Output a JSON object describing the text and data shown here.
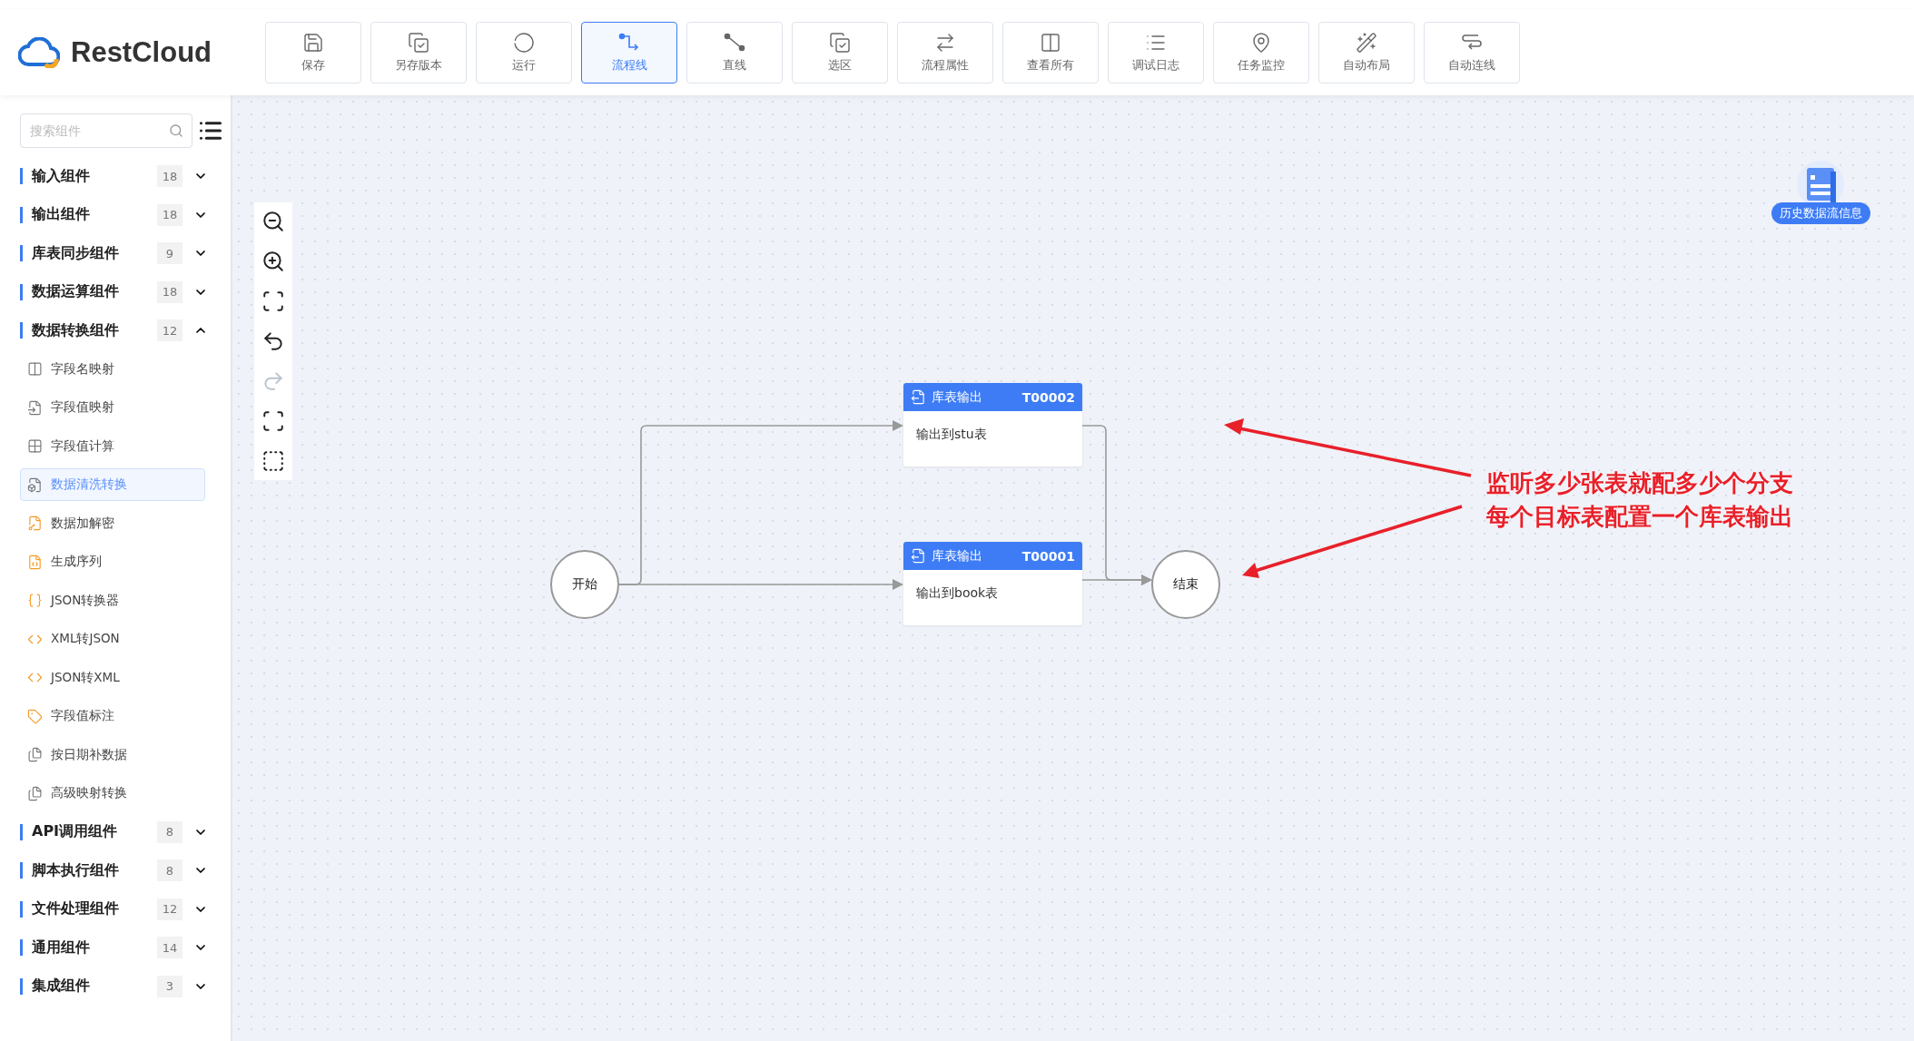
{
  "logo": {
    "text": "RestCloud"
  },
  "toolbar": [
    {
      "label": "保存",
      "selected": false
    },
    {
      "label": "另存版本",
      "selected": false
    },
    {
      "label": "运行",
      "selected": false
    },
    {
      "label": "流程线",
      "selected": true
    },
    {
      "label": "直线",
      "selected": false
    },
    {
      "label": "选区",
      "selected": false
    },
    {
      "label": "流程属性",
      "selected": false
    },
    {
      "label": "查看所有",
      "selected": false
    },
    {
      "label": "调试日志",
      "selected": false
    },
    {
      "label": "任务监控",
      "selected": false
    },
    {
      "label": "自动布局",
      "selected": false
    },
    {
      "label": "自动连线",
      "selected": false
    }
  ],
  "sidebar": {
    "search": {
      "placeholder": "搜索组件"
    },
    "groups": [
      {
        "label": "输入组件",
        "count": "18",
        "expanded": false
      },
      {
        "label": "输出组件",
        "count": "18",
        "expanded": false
      },
      {
        "label": "库表同步组件",
        "count": "9",
        "expanded": false
      },
      {
        "label": "数据运算组件",
        "count": "18",
        "expanded": false
      },
      {
        "label": "数据转换组件",
        "count": "12",
        "expanded": true,
        "children": [
          {
            "label": "字段名映射",
            "selected": false
          },
          {
            "label": "字段值映射",
            "selected": false
          },
          {
            "label": "字段值计算",
            "selected": false
          },
          {
            "label": "数据清洗转换",
            "selected": true
          },
          {
            "label": "数据加解密",
            "selected": false
          },
          {
            "label": "生成序列",
            "selected": false
          },
          {
            "label": "JSON转换器",
            "selected": false
          },
          {
            "label": "XML转JSON",
            "selected": false
          },
          {
            "label": "JSON转XML",
            "selected": false
          },
          {
            "label": "字段值标注",
            "selected": false
          },
          {
            "label": "按日期补数据",
            "selected": false
          },
          {
            "label": "高级映射转换",
            "selected": false
          }
        ]
      },
      {
        "label": "API调用组件",
        "count": "8",
        "expanded": false
      },
      {
        "label": "脚本执行组件",
        "count": "8",
        "expanded": false
      },
      {
        "label": "文件处理组件",
        "count": "12",
        "expanded": false
      },
      {
        "label": "通用组件",
        "count": "14",
        "expanded": false
      },
      {
        "label": "集成组件",
        "count": "3",
        "expanded": false
      }
    ]
  },
  "canvas_tools": [
    {
      "disabled": false
    },
    {
      "disabled": false
    },
    {
      "disabled": false
    },
    {
      "disabled": false
    },
    {
      "disabled": true
    },
    {
      "disabled": false
    },
    {
      "disabled": false
    }
  ],
  "history_button": {
    "label": "历史数据流信息"
  },
  "flow": {
    "nodes": [
      {
        "kind": "start",
        "label": "开始"
      },
      {
        "kind": "task",
        "title": "库表输出",
        "code": "T00002",
        "description": "输出到stu表"
      },
      {
        "kind": "task",
        "title": "库表输出",
        "code": "T00001",
        "description": "输出到book表"
      },
      {
        "kind": "end",
        "label": "结束"
      }
    ]
  },
  "annotation": {
    "lines": [
      "监听多少张表就配多少个分支",
      "每个目标表配置一个库表输出"
    ]
  }
}
